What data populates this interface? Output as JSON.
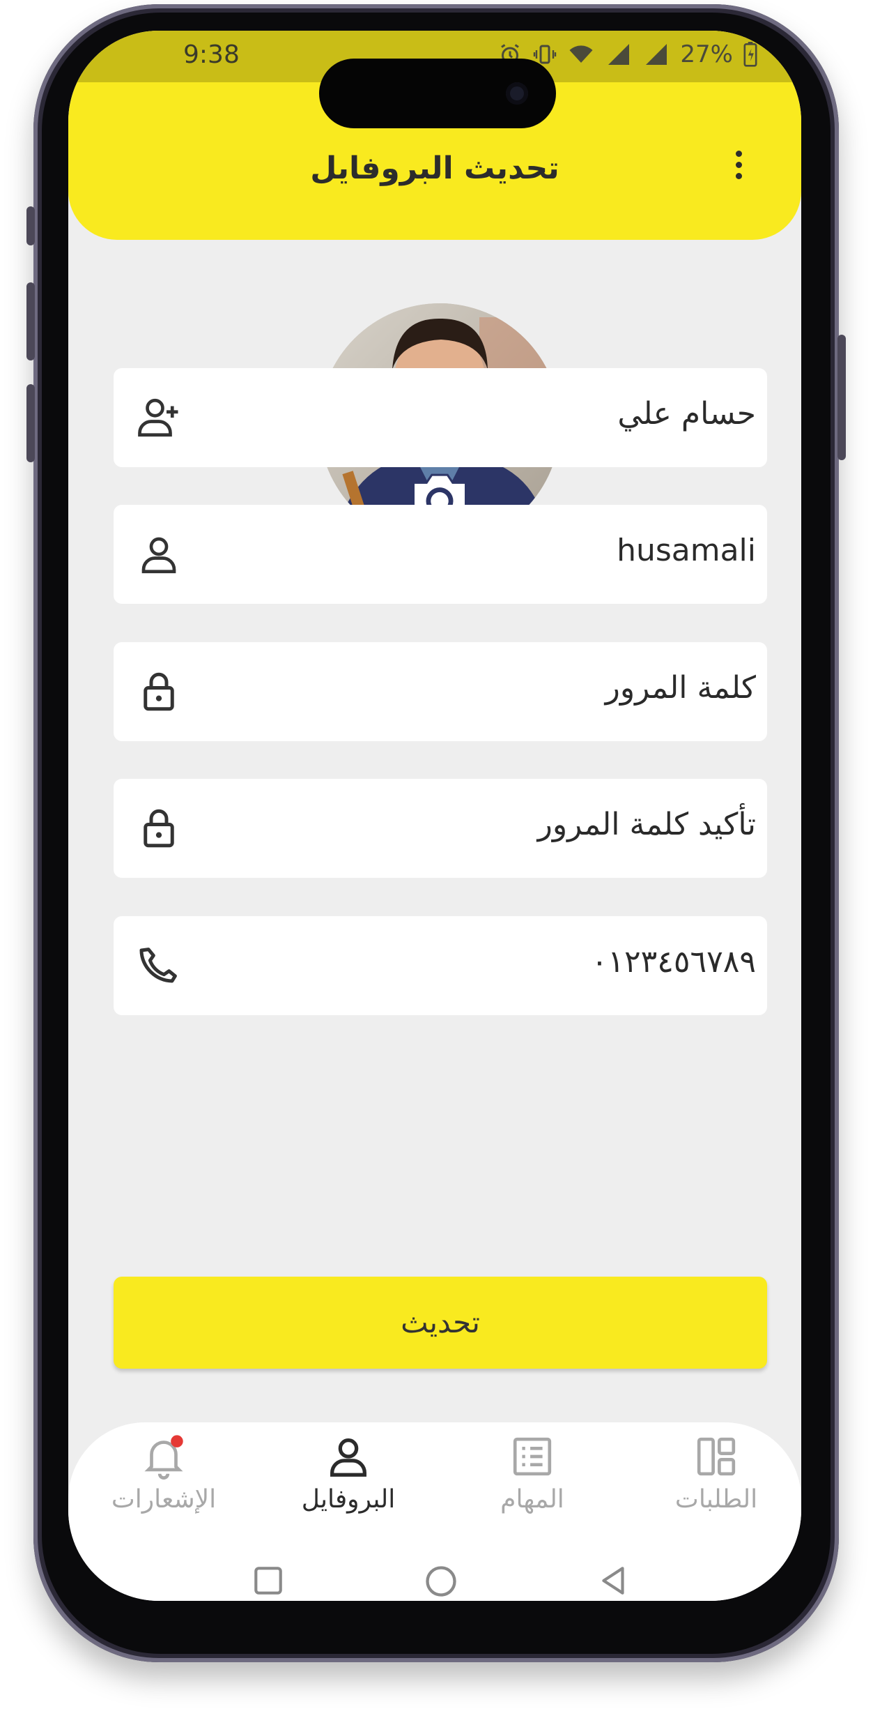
{
  "status_bar": {
    "time": "9:38",
    "battery": "27%"
  },
  "header": {
    "title": "تحديث البروفايل",
    "menu_icon": "more-vert-icon",
    "background_color": "#f9ea1f"
  },
  "profile": {
    "avatar_icon": "profile-photo",
    "camera_icon": "camera-icon"
  },
  "form": {
    "full_name": {
      "value": "حسام علي",
      "icon": "person-add-icon"
    },
    "username": {
      "value": "husamali",
      "icon": "person-icon"
    },
    "password": {
      "value": "كلمة المرور",
      "icon": "lock-icon"
    },
    "confirm_password": {
      "value": "تأكيد كلمة المرور",
      "icon": "lock-icon"
    },
    "phone": {
      "value": "٠١٢٣٤٥٦٧٨٩",
      "icon": "phone-icon"
    },
    "submit_label": "تحديث"
  },
  "bottom_nav": {
    "items": [
      {
        "label": "الإشعارات",
        "icon": "bell-icon",
        "badge": true,
        "active": false
      },
      {
        "label": "البروفايل",
        "icon": "person-icon",
        "active": true
      },
      {
        "label": "المهام",
        "icon": "list-icon",
        "active": false
      },
      {
        "label": "الطلبات",
        "icon": "dashboard-icon",
        "active": false
      }
    ]
  },
  "system_nav": {
    "recent_icon": "square-icon",
    "home_icon": "circle-icon",
    "back_icon": "triangle-back-icon"
  },
  "colors": {
    "accent": "#f9ea1f",
    "status_bar": "#c9bd17",
    "badge": "#e53935",
    "screen_bg": "#eeeeee"
  }
}
